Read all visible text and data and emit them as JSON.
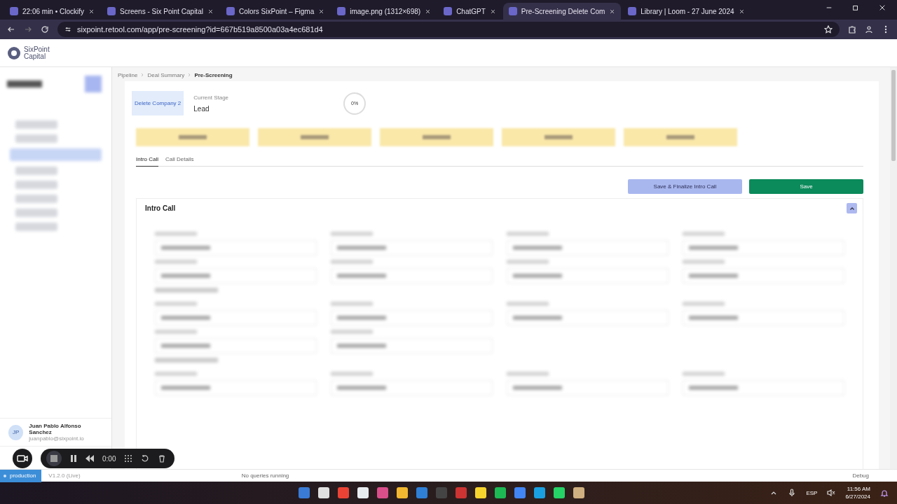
{
  "browser": {
    "tabs": [
      {
        "title": "22:06 min • Clockify",
        "selected": false
      },
      {
        "title": "Screens - Six Point Capital",
        "selected": false
      },
      {
        "title": "Colors SixPoint – Figma",
        "selected": false
      },
      {
        "title": "image.png (1312×698)",
        "selected": false
      },
      {
        "title": "ChatGPT",
        "selected": false
      },
      {
        "title": "Pre-Screening Delete Com",
        "selected": true
      },
      {
        "title": "Library | Loom - 27 June 2024",
        "selected": false
      }
    ],
    "url": "sixpoint.retool.com/app/pre-screening?id=667b519a8500a03a4ec681d4"
  },
  "app": {
    "nav_items": [
      {
        "selected": false
      },
      {
        "selected": false
      },
      {
        "selected": true
      },
      {
        "selected": false
      },
      {
        "selected": false
      },
      {
        "selected": false
      },
      {
        "selected": false
      },
      {
        "selected": false
      }
    ],
    "logo": {
      "line1": "SixPoint",
      "line2": "Capital"
    },
    "breadcrumb": [
      "Pipeline",
      "Deal Summary",
      "Pre-Screening"
    ],
    "company_button": "Delete Company 2",
    "stage_label": "Current Stage",
    "stage": "Lead",
    "progress": "0%",
    "tabs": [
      {
        "label": "Intro Call",
        "selected": true
      },
      {
        "label": "Call Details",
        "selected": false
      }
    ],
    "finalize_button": "Save & Finalize Intro Call",
    "save_button": "Save",
    "section": {
      "title": "Intro Call",
      "expanded": true
    },
    "user": {
      "initials": "JP",
      "name": "Juan Pablo Alfonso Sanchez",
      "email": "juanpablo@sixpoint.io"
    }
  },
  "status_bar": {
    "environment": "production",
    "version": "V1.2.0 (Live)",
    "queries": "No queries running",
    "debug": "Debug"
  },
  "recorder": {
    "time": "0:00"
  },
  "taskbar": {
    "language": "ESP",
    "time": "11:56 AM",
    "date": "6/27/2024"
  }
}
